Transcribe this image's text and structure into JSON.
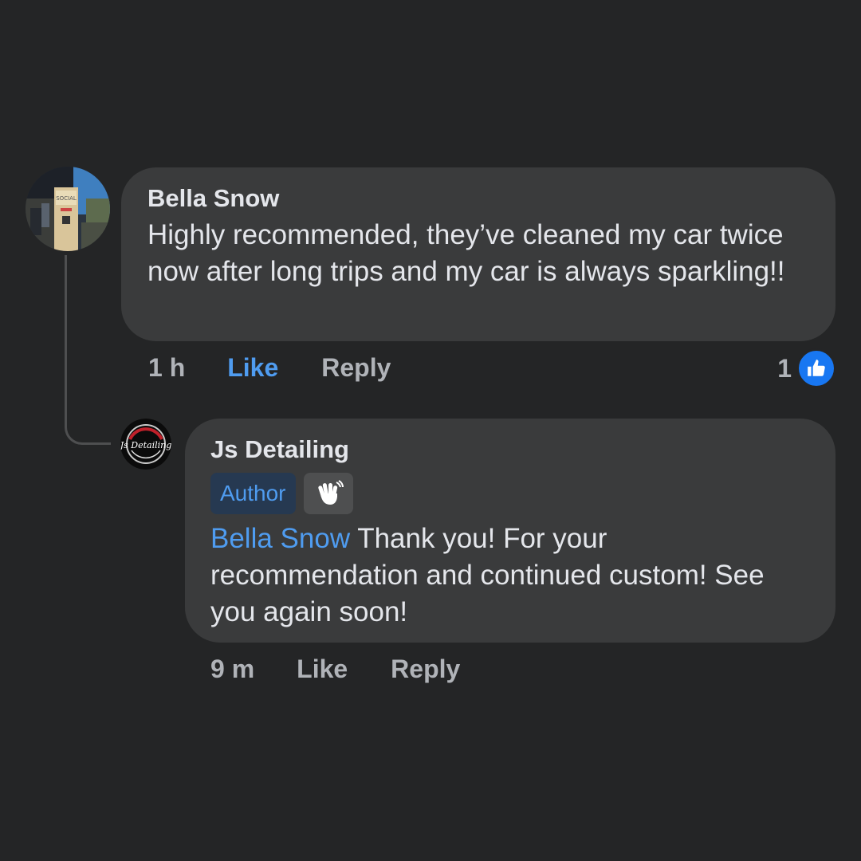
{
  "comment": {
    "author": "Bella Snow",
    "text": "Highly recommended, they’ve cleaned my car twice now after long trips and my car is always sparkling!!",
    "time": "1 h",
    "like_label": "Like",
    "reply_label": "Reply",
    "reaction_count": "1",
    "avatar_sign_text": "SOCIAL",
    "reaction_icon": "thumbs-up-icon"
  },
  "reply": {
    "author": "Js Detailing",
    "badge_label": "Author",
    "badge_icon": "wave-icon",
    "mention": "Bella Snow",
    "text": " Thank you! For your recommendation and continued custom! See you again soon!",
    "time": "9 m",
    "like_label": "Like",
    "reply_label": "Reply",
    "avatar_logo_text": "Js Detailing"
  },
  "colors": {
    "background": "#242526",
    "bubble": "#3a3b3c",
    "text": "#e4e6eb",
    "secondary_text": "#b0b3b8",
    "accent_blue": "#4f9cf0",
    "like_blue": "#1877f2"
  }
}
